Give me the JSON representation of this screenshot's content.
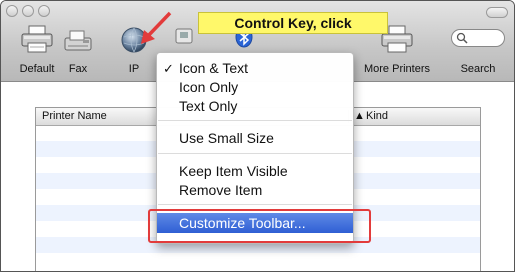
{
  "toolbar": {
    "items": [
      {
        "label": "Default",
        "icon": "printer-icon"
      },
      {
        "label": "Fax",
        "icon": "fax-icon"
      },
      {
        "label": "IP",
        "icon": "globe-icon"
      },
      {
        "label": "More Printers",
        "icon": "printer-icon"
      },
      {
        "label": "Search",
        "icon": "search-icon"
      }
    ]
  },
  "callout": {
    "text": "Control Key, click",
    "background": "#fff86a"
  },
  "table": {
    "columns": [
      "Printer Name",
      "Kind"
    ],
    "sort_column": "Kind"
  },
  "context_menu": {
    "items": [
      {
        "label": "Icon & Text",
        "checked": true
      },
      {
        "label": "Icon Only"
      },
      {
        "label": "Text Only"
      },
      {
        "label": "Use Small Size"
      },
      {
        "label": "Keep Item Visible"
      },
      {
        "label": "Remove Item"
      },
      {
        "label": "Customize Toolbar...",
        "selected": true
      }
    ],
    "check_mark": "✓"
  },
  "colors": {
    "annotation_red": "#e23b3b",
    "selection_blue": "#2f5fd4"
  }
}
